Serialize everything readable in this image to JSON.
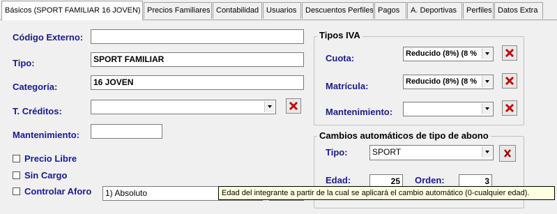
{
  "tabs": [
    {
      "label": "Básicos (SPORT FAMILIAR 16 JOVEN)",
      "active": true
    },
    {
      "label": "Precios Familiares"
    },
    {
      "label": "Contabilidad"
    },
    {
      "label": "Usuarios"
    },
    {
      "label": "Descuentos Perfiles"
    },
    {
      "label": "Pagos"
    },
    {
      "label": "A. Deportivas"
    },
    {
      "label": "Perfiles"
    },
    {
      "label": "Datos Extra"
    }
  ],
  "form": {
    "codigo_externo_label": "Código Externo:",
    "codigo_externo_value": "",
    "tipo_label": "Tipo:",
    "tipo_value": "SPORT FAMILIAR",
    "categoria_label": "Categoría:",
    "categoria_value": "16 JOVEN",
    "t_creditos_label": "T. Créditos:",
    "t_creditos_value": "",
    "mantenimiento_label": "Mantenimiento:",
    "mantenimiento_value": "",
    "precio_libre_label": "Precio Libre",
    "sin_cargo_label": "Sin Cargo",
    "controlar_aforo_label": "Controlar Aforo",
    "aforo_value": "1) Absoluto"
  },
  "tipos_iva": {
    "title": "Tipos IVA",
    "cuota_label": "Cuota:",
    "cuota_value": "Reducido (8%)  (8 %",
    "matricula_label": "Matrícula:",
    "matricula_value": "Reducido (8%)  (8 %",
    "mantenimiento_label": "Mantenimiento:",
    "mantenimiento_value": ""
  },
  "cambios": {
    "title": "Cambios automáticos de tipo de abono",
    "tipo_label": "Tipo:",
    "tipo_value": "SPORT",
    "edad_label": "Edad:",
    "edad_value": "25",
    "orden_label": "Orden:",
    "orden_value": "3"
  },
  "tooltip": "Edad del integrante a partir de la cual se aplicará el cambio automático (0-cualquier edad).",
  "colors": {
    "label_blue": "#1a1a8c",
    "delete_red": "#cc0000",
    "tooltip_bg": "#ffffe1"
  }
}
